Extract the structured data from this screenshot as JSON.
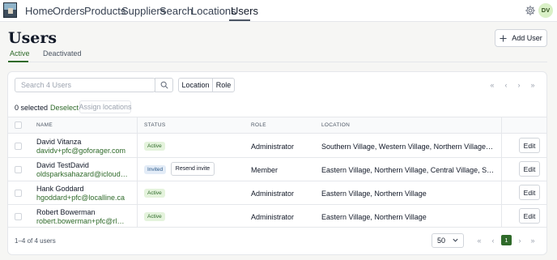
{
  "nav": {
    "items": [
      {
        "label": "Home",
        "active": false
      },
      {
        "label": "Orders",
        "active": false
      },
      {
        "label": "Products",
        "active": false
      },
      {
        "label": "Suppliers",
        "active": false
      },
      {
        "label": "Search",
        "active": false
      },
      {
        "label": "Locations",
        "active": false
      },
      {
        "label": "Users",
        "active": true
      }
    ],
    "avatar_initials": "DV",
    "settings_icon": "gear-icon"
  },
  "page": {
    "title": "Users",
    "add_user_label": "Add User",
    "tabs": [
      {
        "label": "Active",
        "active": true
      },
      {
        "label": "Deactivated",
        "active": false
      }
    ]
  },
  "toolbar": {
    "search_placeholder": "Search 4 Users",
    "search_value": "",
    "location_label": "Location",
    "role_label": "Role"
  },
  "selection": {
    "count_label": "0 selected",
    "deselect_label": "Deselect",
    "assign_label": "Assign locations"
  },
  "table": {
    "headers": [
      "NAME",
      "STATUS",
      "ROLE",
      "LOCATION"
    ],
    "rows": [
      {
        "name": "David Vitanza",
        "email": "davidv+pfc@goforager.com",
        "status": "Active",
        "role": "Administrator",
        "location": "Southern Village, Western Village, Northern Village, Eastern Village",
        "action": "Edit"
      },
      {
        "name": "David TestDavid",
        "email": "oldsparksahazard@icloud.com",
        "status": "Invited",
        "resend": "Resend invite",
        "role": "Member",
        "location": "Eastern Village, Northern Village, Central Village, Southern Village",
        "action": "Edit"
      },
      {
        "name": "Hank Goddard",
        "email": "hgoddard+pfc@localline.ca",
        "status": "Active",
        "role": "Administrator",
        "location": "Eastern Village, Northern Village",
        "action": "Edit"
      },
      {
        "name": "Robert Bowerman",
        "email": "robert.bowerman+pfc@rlmicrosystems.com",
        "status": "Active",
        "role": "Administrator",
        "location": "Eastern Village, Northern Village",
        "action": "Edit"
      }
    ]
  },
  "footer": {
    "count_label": "1–4 of 4 users",
    "page_size": "50",
    "current_page": "1"
  },
  "colors": {
    "accent": "#2f6a2a",
    "active_badge_bg": "#e4f3dc",
    "invited_badge_bg": "#e3ecf7",
    "avatar_bg": "#d9f0c6"
  }
}
